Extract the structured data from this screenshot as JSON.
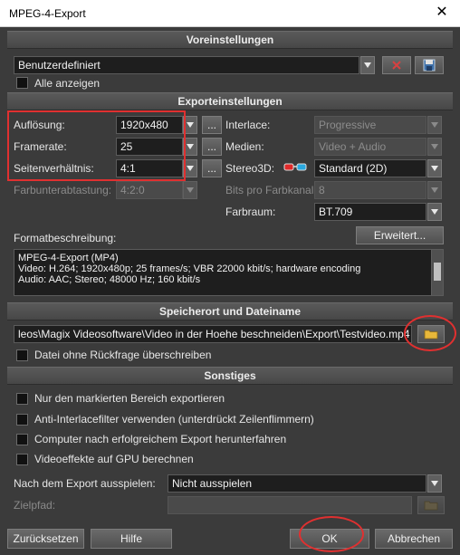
{
  "window": {
    "title": "MPEG-4-Export",
    "close_glyph": "✕"
  },
  "presets": {
    "header": "Voreinstellungen",
    "selected": "Benutzerdefiniert",
    "show_all": "Alle anzeigen"
  },
  "export_settings": {
    "header": "Exporteinstellungen",
    "resolution_label": "Auflösung:",
    "resolution_value": "1920x480",
    "framerate_label": "Framerate:",
    "framerate_value": "25",
    "aspect_label": "Seitenverhältnis:",
    "aspect_value": "4:1",
    "chroma_label": "Farbunterabtastung:",
    "chroma_value": "4:2:0",
    "interlace_label": "Interlace:",
    "interlace_value": "Progressive",
    "media_label": "Medien:",
    "media_value": "Video + Audio",
    "stereo_label": "Stereo3D:",
    "stereo_value": "Standard (2D)",
    "bits_label": "Bits pro Farbkanal:",
    "bits_value": "8",
    "colorspace_label": "Farbraum:",
    "colorspace_value": "BT.709",
    "more_button": "...",
    "format_desc_label": "Formatbeschreibung:",
    "advanced_button": "Erweitert...",
    "format_desc_lines": [
      "MPEG-4-Export (MP4)",
      "Video: H.264; 1920x480p; 25 frames/s; VBR 22000 kbit/s; hardware encoding",
      "Audio: AAC; Stereo; 48000 Hz; 160 kbit/s"
    ]
  },
  "location": {
    "header": "Speicherort und Dateiname",
    "path": "leos\\Magix Videosoftware\\Video in der Hoehe beschneiden\\Export\\Testvideo.mp4",
    "overwrite": "Datei ohne Rückfrage überschreiben"
  },
  "misc": {
    "header": "Sonstiges",
    "opt1": "Nur den markierten Bereich exportieren",
    "opt2": "Anti-Interlacefilter verwenden (unterdrückt Zeilenflimmern)",
    "opt3": "Computer nach erfolgreichem Export herunterfahren",
    "opt4": "Videoeffekte auf GPU berechnen",
    "after_export_label": "Nach dem Export ausspielen:",
    "after_export_value": "Nicht ausspielen",
    "target_label": "Zielpfad:"
  },
  "footer": {
    "reset": "Zurücksetzen",
    "help": "Hilfe",
    "ok": "OK",
    "cancel": "Abbrechen"
  },
  "colors": {
    "annotation": "#e03030",
    "folder": "#e8b83a"
  },
  "icons": [
    "close-icon",
    "delete-preset-icon",
    "save-preset-icon",
    "anaglyph-glasses-icon",
    "folder-icon"
  ]
}
